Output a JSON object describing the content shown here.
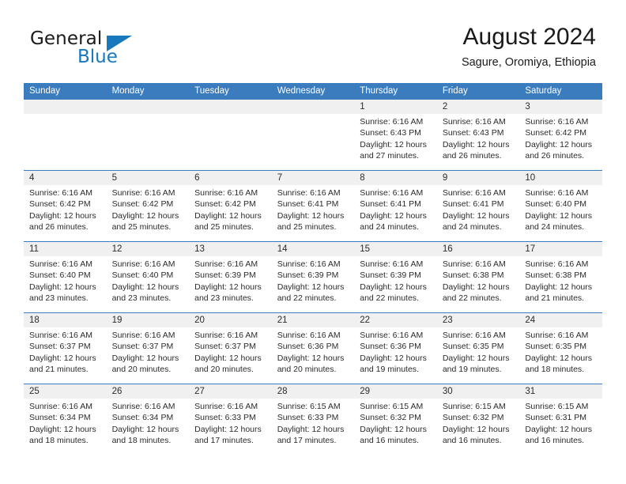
{
  "brand": {
    "word_one": "General",
    "word_two": "Blue",
    "accent_color": "#1878be"
  },
  "header": {
    "title": "August 2024",
    "subtitle": "Sagure, Oromiya, Ethiopia",
    "header_bg_color": "#3a7cbe"
  },
  "weekdays": [
    "Sunday",
    "Monday",
    "Tuesday",
    "Wednesday",
    "Thursday",
    "Friday",
    "Saturday"
  ],
  "weeks": [
    [
      {
        "day": "",
        "lines": []
      },
      {
        "day": "",
        "lines": []
      },
      {
        "day": "",
        "lines": []
      },
      {
        "day": "",
        "lines": []
      },
      {
        "day": "1",
        "lines": [
          "Sunrise: 6:16 AM",
          "Sunset: 6:43 PM",
          "Daylight: 12 hours",
          "and 27 minutes."
        ]
      },
      {
        "day": "2",
        "lines": [
          "Sunrise: 6:16 AM",
          "Sunset: 6:43 PM",
          "Daylight: 12 hours",
          "and 26 minutes."
        ]
      },
      {
        "day": "3",
        "lines": [
          "Sunrise: 6:16 AM",
          "Sunset: 6:42 PM",
          "Daylight: 12 hours",
          "and 26 minutes."
        ]
      }
    ],
    [
      {
        "day": "4",
        "lines": [
          "Sunrise: 6:16 AM",
          "Sunset: 6:42 PM",
          "Daylight: 12 hours",
          "and 26 minutes."
        ]
      },
      {
        "day": "5",
        "lines": [
          "Sunrise: 6:16 AM",
          "Sunset: 6:42 PM",
          "Daylight: 12 hours",
          "and 25 minutes."
        ]
      },
      {
        "day": "6",
        "lines": [
          "Sunrise: 6:16 AM",
          "Sunset: 6:42 PM",
          "Daylight: 12 hours",
          "and 25 minutes."
        ]
      },
      {
        "day": "7",
        "lines": [
          "Sunrise: 6:16 AM",
          "Sunset: 6:41 PM",
          "Daylight: 12 hours",
          "and 25 minutes."
        ]
      },
      {
        "day": "8",
        "lines": [
          "Sunrise: 6:16 AM",
          "Sunset: 6:41 PM",
          "Daylight: 12 hours",
          "and 24 minutes."
        ]
      },
      {
        "day": "9",
        "lines": [
          "Sunrise: 6:16 AM",
          "Sunset: 6:41 PM",
          "Daylight: 12 hours",
          "and 24 minutes."
        ]
      },
      {
        "day": "10",
        "lines": [
          "Sunrise: 6:16 AM",
          "Sunset: 6:40 PM",
          "Daylight: 12 hours",
          "and 24 minutes."
        ]
      }
    ],
    [
      {
        "day": "11",
        "lines": [
          "Sunrise: 6:16 AM",
          "Sunset: 6:40 PM",
          "Daylight: 12 hours",
          "and 23 minutes."
        ]
      },
      {
        "day": "12",
        "lines": [
          "Sunrise: 6:16 AM",
          "Sunset: 6:40 PM",
          "Daylight: 12 hours",
          "and 23 minutes."
        ]
      },
      {
        "day": "13",
        "lines": [
          "Sunrise: 6:16 AM",
          "Sunset: 6:39 PM",
          "Daylight: 12 hours",
          "and 23 minutes."
        ]
      },
      {
        "day": "14",
        "lines": [
          "Sunrise: 6:16 AM",
          "Sunset: 6:39 PM",
          "Daylight: 12 hours",
          "and 22 minutes."
        ]
      },
      {
        "day": "15",
        "lines": [
          "Sunrise: 6:16 AM",
          "Sunset: 6:39 PM",
          "Daylight: 12 hours",
          "and 22 minutes."
        ]
      },
      {
        "day": "16",
        "lines": [
          "Sunrise: 6:16 AM",
          "Sunset: 6:38 PM",
          "Daylight: 12 hours",
          "and 22 minutes."
        ]
      },
      {
        "day": "17",
        "lines": [
          "Sunrise: 6:16 AM",
          "Sunset: 6:38 PM",
          "Daylight: 12 hours",
          "and 21 minutes."
        ]
      }
    ],
    [
      {
        "day": "18",
        "lines": [
          "Sunrise: 6:16 AM",
          "Sunset: 6:37 PM",
          "Daylight: 12 hours",
          "and 21 minutes."
        ]
      },
      {
        "day": "19",
        "lines": [
          "Sunrise: 6:16 AM",
          "Sunset: 6:37 PM",
          "Daylight: 12 hours",
          "and 20 minutes."
        ]
      },
      {
        "day": "20",
        "lines": [
          "Sunrise: 6:16 AM",
          "Sunset: 6:37 PM",
          "Daylight: 12 hours",
          "and 20 minutes."
        ]
      },
      {
        "day": "21",
        "lines": [
          "Sunrise: 6:16 AM",
          "Sunset: 6:36 PM",
          "Daylight: 12 hours",
          "and 20 minutes."
        ]
      },
      {
        "day": "22",
        "lines": [
          "Sunrise: 6:16 AM",
          "Sunset: 6:36 PM",
          "Daylight: 12 hours",
          "and 19 minutes."
        ]
      },
      {
        "day": "23",
        "lines": [
          "Sunrise: 6:16 AM",
          "Sunset: 6:35 PM",
          "Daylight: 12 hours",
          "and 19 minutes."
        ]
      },
      {
        "day": "24",
        "lines": [
          "Sunrise: 6:16 AM",
          "Sunset: 6:35 PM",
          "Daylight: 12 hours",
          "and 18 minutes."
        ]
      }
    ],
    [
      {
        "day": "25",
        "lines": [
          "Sunrise: 6:16 AM",
          "Sunset: 6:34 PM",
          "Daylight: 12 hours",
          "and 18 minutes."
        ]
      },
      {
        "day": "26",
        "lines": [
          "Sunrise: 6:16 AM",
          "Sunset: 6:34 PM",
          "Daylight: 12 hours",
          "and 18 minutes."
        ]
      },
      {
        "day": "27",
        "lines": [
          "Sunrise: 6:16 AM",
          "Sunset: 6:33 PM",
          "Daylight: 12 hours",
          "and 17 minutes."
        ]
      },
      {
        "day": "28",
        "lines": [
          "Sunrise: 6:15 AM",
          "Sunset: 6:33 PM",
          "Daylight: 12 hours",
          "and 17 minutes."
        ]
      },
      {
        "day": "29",
        "lines": [
          "Sunrise: 6:15 AM",
          "Sunset: 6:32 PM",
          "Daylight: 12 hours",
          "and 16 minutes."
        ]
      },
      {
        "day": "30",
        "lines": [
          "Sunrise: 6:15 AM",
          "Sunset: 6:32 PM",
          "Daylight: 12 hours",
          "and 16 minutes."
        ]
      },
      {
        "day": "31",
        "lines": [
          "Sunrise: 6:15 AM",
          "Sunset: 6:31 PM",
          "Daylight: 12 hours",
          "and 16 minutes."
        ]
      }
    ]
  ]
}
